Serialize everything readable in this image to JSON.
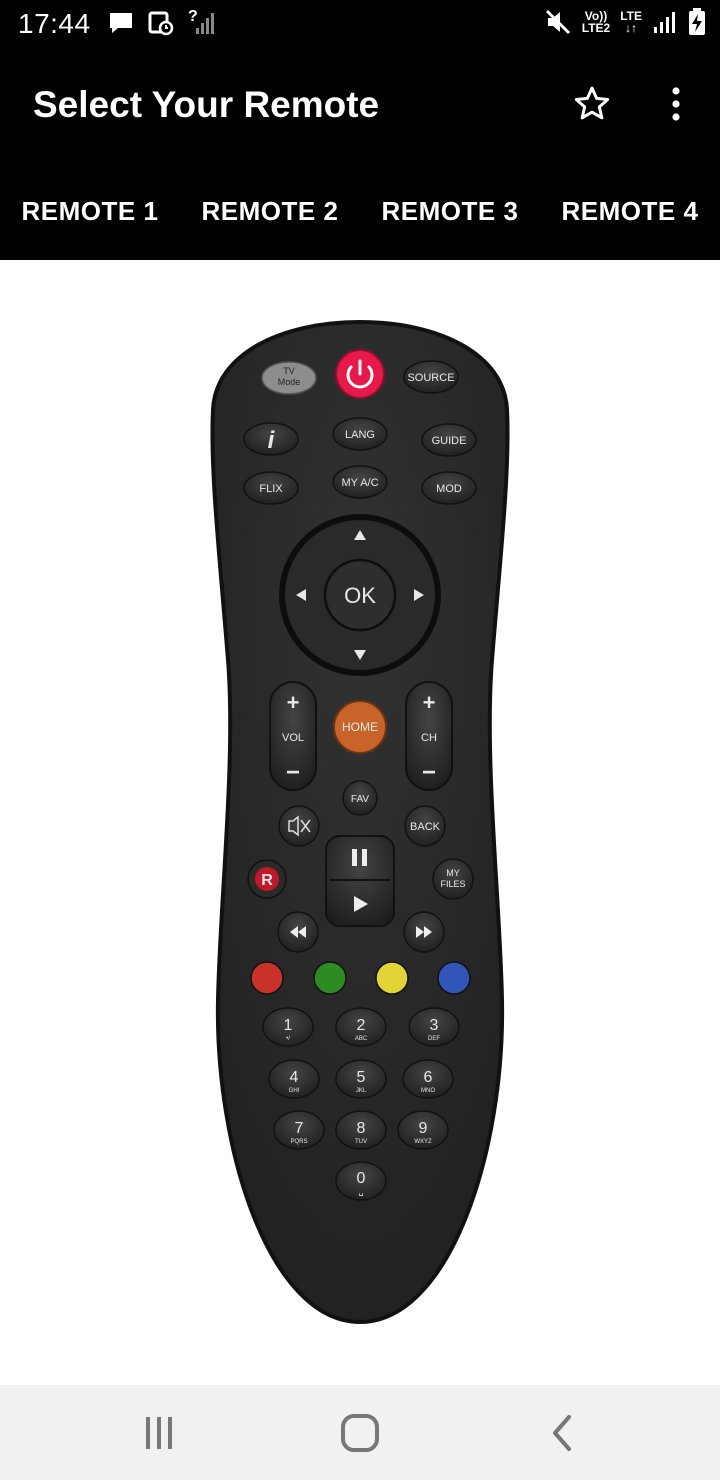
{
  "status_bar": {
    "time": "17:44",
    "unknown_signal": "?",
    "volte": "Vo))",
    "lte2": "LTE2",
    "lte": "LTE"
  },
  "app_bar": {
    "title": "Select Your Remote",
    "favorite_icon": "star-outline-icon",
    "menu_icon": "more-vert-icon"
  },
  "tabs": [
    {
      "label": "REMOTE 1"
    },
    {
      "label": "REMOTE 2"
    },
    {
      "label": "REMOTE 3"
    },
    {
      "label": "REMOTE 4"
    }
  ],
  "remote": {
    "tv_mode_line1": "TV",
    "tv_mode_line2": "Mode",
    "source": "SOURCE",
    "info": "i",
    "lang": "LANG",
    "guide": "GUIDE",
    "flix": "FLIX",
    "my_ac": "MY A/C",
    "mod": "MOD",
    "ok": "OK",
    "vol_plus": "+",
    "vol": "VOL",
    "vol_minus": "−",
    "home": "HOME",
    "ch_plus": "+",
    "ch": "CH",
    "ch_minus": "−",
    "fav": "FAV",
    "back": "BACK",
    "record": "R",
    "my_files_line1": "MY",
    "my_files_line2": "FILES",
    "keys": [
      {
        "digit": "1",
        "letters": "•/"
      },
      {
        "digit": "2",
        "letters": "ABC"
      },
      {
        "digit": "3",
        "letters": "DEF"
      },
      {
        "digit": "4",
        "letters": "GHI"
      },
      {
        "digit": "5",
        "letters": "JKL"
      },
      {
        "digit": "6",
        "letters": "MNO"
      },
      {
        "digit": "7",
        "letters": "PQRS"
      },
      {
        "digit": "8",
        "letters": "TUV"
      },
      {
        "digit": "9",
        "letters": "WXYZ"
      },
      {
        "digit": "0",
        "letters": "␣"
      }
    ],
    "colors": {
      "power": "#e8194a",
      "home": "#c8642a",
      "record": "#c0182a",
      "red": "#c9322a",
      "green": "#2e8b24",
      "yellow": "#e2d434",
      "blue": "#3256b8"
    }
  }
}
